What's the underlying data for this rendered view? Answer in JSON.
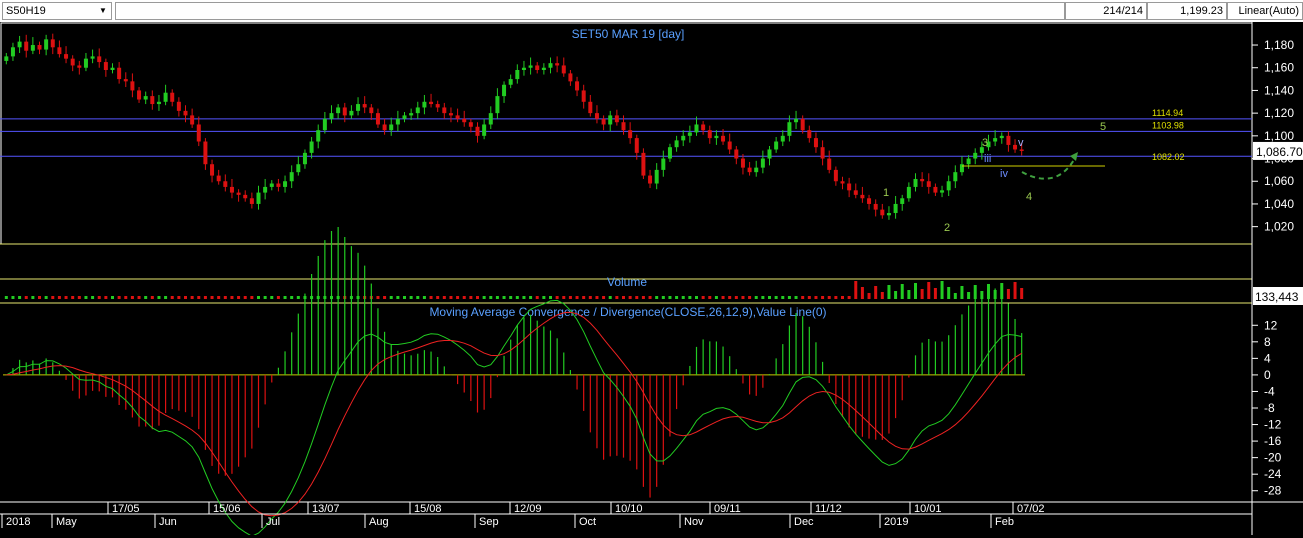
{
  "toolbar": {
    "symbol": "S50H19",
    "bars": "214/214",
    "last_value": "1,199.23",
    "scale_mode": "Linear(Auto)"
  },
  "price_panel": {
    "title": "SET50 MAR 19   [day]",
    "current_price": "1,086.70",
    "y_ticks": [
      "1,180",
      "1,160",
      "1,140",
      "1,120",
      "1,100",
      "1,080",
      "1,060",
      "1,040",
      "1,020"
    ],
    "levels": [
      {
        "label": "1114.94",
        "value": 1114.94
      },
      {
        "label": "1103.98",
        "value": 1103.98
      },
      {
        "label": "1082.02",
        "value": 1082.02
      }
    ],
    "wave_labels": [
      "5",
      "3",
      "v",
      "iii",
      "iv",
      "4",
      "1",
      "2"
    ],
    "colors": {
      "up": "#22cc22",
      "down": "#dd1111",
      "level_line": "#5555ff",
      "label": "#e0e000"
    }
  },
  "volume_panel": {
    "title": "Volume",
    "current_value": "133,443"
  },
  "macd_panel": {
    "title": "Moving Average Convergence / Divergence(CLOSE,26,12,9),Value Line(0)",
    "y_ticks": [
      "12",
      "8",
      "4",
      "0",
      "-4",
      "-8",
      "-12",
      "-16",
      "-20",
      "-24",
      "-28"
    ]
  },
  "x_axis": {
    "top_row": [
      "17/05",
      "15/06",
      "13/07",
      "15/08",
      "12/09",
      "10/10",
      "09/11",
      "11/12",
      "10/01",
      "07/02"
    ],
    "bottom_row": [
      "2018",
      "May",
      "Jun",
      "Jul",
      "Aug",
      "Sep",
      "Oct",
      "Nov",
      "Dec",
      "2019",
      "Feb"
    ]
  },
  "chart_data": {
    "type": "candlestick",
    "title": "SET50 MAR 19   [day]",
    "close_approx": [
      1170,
      1178,
      1183,
      1175,
      1180,
      1176,
      1185,
      1178,
      1172,
      1168,
      1162,
      1160,
      1168,
      1170,
      1165,
      1158,
      1160,
      1150,
      1148,
      1140,
      1132,
      1135,
      1128,
      1130,
      1138,
      1130,
      1122,
      1118,
      1110,
      1095,
      1075,
      1065,
      1060,
      1055,
      1050,
      1048,
      1045,
      1040,
      1050,
      1055,
      1058,
      1055,
      1060,
      1068,
      1075,
      1085,
      1095,
      1105,
      1115,
      1120,
      1125,
      1118,
      1122,
      1128,
      1125,
      1120,
      1110,
      1105,
      1110,
      1115,
      1118,
      1120,
      1125,
      1130,
      1128,
      1125,
      1120,
      1118,
      1115,
      1112,
      1108,
      1100,
      1110,
      1120,
      1135,
      1145,
      1150,
      1158,
      1160,
      1162,
      1158,
      1160,
      1164,
      1162,
      1155,
      1148,
      1140,
      1130,
      1120,
      1115,
      1110,
      1118,
      1112,
      1105,
      1098,
      1085,
      1065,
      1058,
      1070,
      1080,
      1090,
      1096,
      1100,
      1103,
      1110,
      1105,
      1098,
      1100,
      1095,
      1088,
      1080,
      1072,
      1068,
      1072,
      1080,
      1088,
      1095,
      1100,
      1112,
      1115,
      1105,
      1098,
      1090,
      1080,
      1070,
      1060,
      1058,
      1052,
      1048,
      1045,
      1040,
      1035,
      1030,
      1032,
      1040,
      1045,
      1055,
      1062,
      1060,
      1055,
      1050,
      1052,
      1060,
      1068,
      1075,
      1080,
      1085,
      1090,
      1095,
      1098,
      1100,
      1092,
      1088,
      1086.7
    ],
    "ylim": [
      1010,
      1195
    ],
    "levels": [
      1114.94,
      1103.98,
      1082.02
    ],
    "volume_last": 133443,
    "macd_ylim": [
      -30,
      14
    ]
  }
}
